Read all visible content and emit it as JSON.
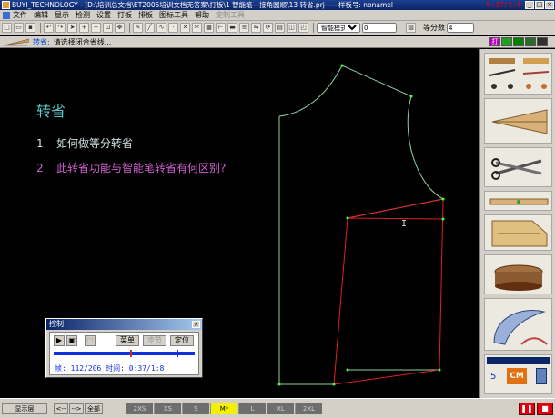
{
  "window": {
    "title": "BUYI_TECHNOLOGY - [D:\\培训总文档\\ET2005培训文档无答案\\打板\\1 智能笔—接角圆顺\\13 转省.prj——样板号: nonamel",
    "timer": "0:37/1:8"
  },
  "menu": {
    "items": [
      {
        "label": "文件",
        "enabled": true
      },
      {
        "label": "编辑",
        "enabled": true
      },
      {
        "label": "显示",
        "enabled": true
      },
      {
        "label": "检测",
        "enabled": true
      },
      {
        "label": "设置",
        "enabled": true
      },
      {
        "label": "打板",
        "enabled": true
      },
      {
        "label": "排板",
        "enabled": true
      },
      {
        "label": "图标工具",
        "enabled": true
      },
      {
        "label": "帮助",
        "enabled": true
      },
      {
        "label": "定制工具",
        "enabled": false
      }
    ]
  },
  "toolbar": {
    "mode_select": "智能模式F5",
    "mode_value": "0",
    "equal_label": "等分数",
    "equal_value": "4"
  },
  "prompt": {
    "label": "转省:",
    "text": "请选择闭合省线..."
  },
  "slide": {
    "title": "转省",
    "questions": [
      {
        "num": "1",
        "text": "如何做等分转省"
      },
      {
        "num": "2",
        "text": "此转省功能与智能笔转省有何区别?"
      }
    ]
  },
  "controller": {
    "title": "控制",
    "menu_label": "菜单",
    "step_label": "步节",
    "locate_label": "定位",
    "status": "帧: 112/206 时间: 0:37/1:8",
    "progress": 0.54
  },
  "panel": {
    "number_label": "5",
    "cm_label": "CM"
  },
  "statusbar": {
    "display_layer": "显示层",
    "prev_label": "<--",
    "next_label": "-->",
    "all_label": "全部",
    "sizes": [
      "2XS",
      "XS",
      "S",
      "M*",
      "L",
      "XL",
      "2XL"
    ],
    "active_size": "M*"
  },
  "colors": {
    "canvas_bg": "#000000",
    "pattern_green": "#8fd0a0",
    "pattern_red": "#e02020",
    "title_cyan": "#55c8c8",
    "question2_magenta": "#d060d0"
  }
}
